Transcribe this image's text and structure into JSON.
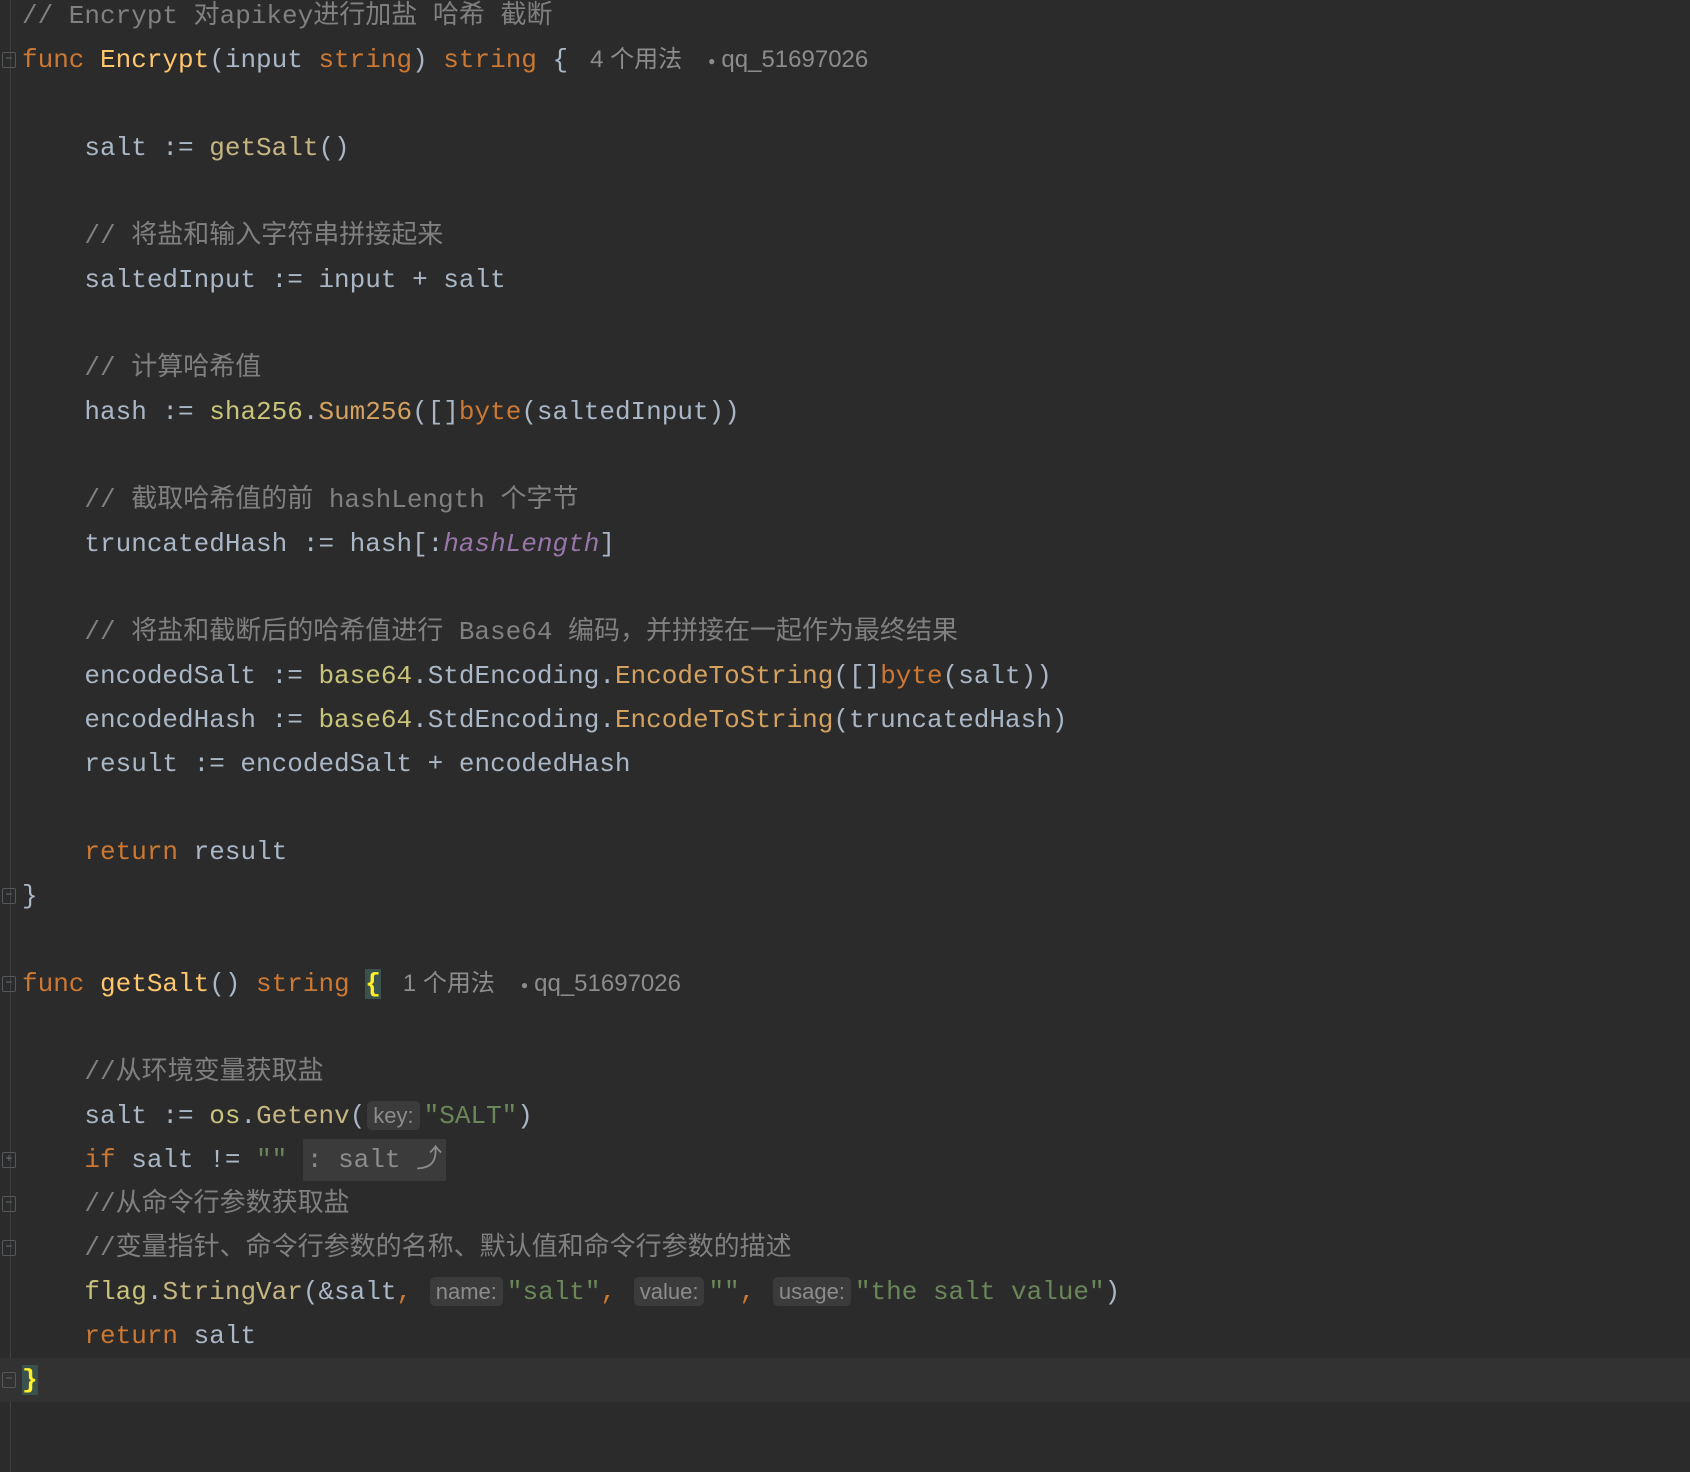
{
  "editor": {
    "language": "Go",
    "current_line": 31,
    "lines": [
      {
        "fold": null,
        "tokens": [
          [
            "cm",
            "// Encrypt 对apikey进行加盐 哈希 截断"
          ]
        ]
      },
      {
        "fold": "open",
        "tokens": [
          [
            "kw",
            "func "
          ],
          [
            "fn",
            "Encrypt"
          ],
          [
            "plain",
            "(input "
          ],
          [
            "kw",
            "string"
          ],
          [
            "plain",
            ") "
          ],
          [
            "kw",
            "string"
          ],
          [
            "plain",
            " {"
          ],
          [
            "usage",
            "4 个用法"
          ],
          [
            "author",
            "qq_51697026"
          ]
        ]
      },
      {
        "fold": null,
        "tokens": []
      },
      {
        "fold": null,
        "tokens": [
          [
            "plain",
            "    salt := "
          ],
          [
            "call",
            "getSalt"
          ],
          [
            "plain",
            "()"
          ]
        ]
      },
      {
        "fold": null,
        "tokens": []
      },
      {
        "fold": null,
        "tokens": [
          [
            "cm",
            "    // 将盐和输入字符串拼接起来"
          ]
        ]
      },
      {
        "fold": null,
        "tokens": [
          [
            "plain",
            "    saltedInput := input + salt"
          ]
        ]
      },
      {
        "fold": null,
        "tokens": []
      },
      {
        "fold": null,
        "tokens": [
          [
            "cm",
            "    // 计算哈希值"
          ]
        ]
      },
      {
        "fold": null,
        "tokens": [
          [
            "plain",
            "    hash := "
          ],
          [
            "pkg",
            "sha256"
          ],
          [
            "plain",
            "."
          ],
          [
            "method",
            "Sum256"
          ],
          [
            "plain",
            "([]"
          ],
          [
            "kw",
            "byte"
          ],
          [
            "plain",
            "(saltedInput))"
          ]
        ]
      },
      {
        "fold": null,
        "tokens": []
      },
      {
        "fold": null,
        "tokens": [
          [
            "cm",
            "    // 截取哈希值的前 hashLength 个字节"
          ]
        ]
      },
      {
        "fold": null,
        "tokens": [
          [
            "plain",
            "    truncatedHash := hash[:"
          ],
          [
            "const",
            "hashLength"
          ],
          [
            "plain",
            "]"
          ]
        ]
      },
      {
        "fold": null,
        "tokens": []
      },
      {
        "fold": null,
        "tokens": [
          [
            "cm",
            "    // 将盐和截断后的哈希值进行 Base64 编码，并拼接在一起作为最终结果"
          ]
        ]
      },
      {
        "fold": null,
        "tokens": [
          [
            "plain",
            "    encodedSalt := "
          ],
          [
            "pkg",
            "base64"
          ],
          [
            "plain",
            "."
          ],
          [
            "plain",
            "StdEncoding"
          ],
          [
            "plain",
            "."
          ],
          [
            "method",
            "EncodeToString"
          ],
          [
            "plain",
            "([]"
          ],
          [
            "kw",
            "byte"
          ],
          [
            "plain",
            "(salt))"
          ]
        ]
      },
      {
        "fold": null,
        "tokens": [
          [
            "plain",
            "    encodedHash := "
          ],
          [
            "pkg",
            "base64"
          ],
          [
            "plain",
            "."
          ],
          [
            "plain",
            "StdEncoding"
          ],
          [
            "plain",
            "."
          ],
          [
            "method",
            "EncodeToString"
          ],
          [
            "plain",
            "(truncatedHash)"
          ]
        ]
      },
      {
        "fold": null,
        "tokens": [
          [
            "plain",
            "    result := encodedSalt + encodedHash"
          ]
        ]
      },
      {
        "fold": null,
        "tokens": []
      },
      {
        "fold": null,
        "tokens": [
          [
            "kw",
            "    return"
          ],
          [
            "plain",
            " result"
          ]
        ]
      },
      {
        "fold": "end",
        "tokens": [
          [
            "plain",
            "}"
          ]
        ]
      },
      {
        "fold": null,
        "tokens": []
      },
      {
        "fold": "open",
        "tokens": [
          [
            "kw",
            "func "
          ],
          [
            "fn",
            "getSalt"
          ],
          [
            "plain",
            "() "
          ],
          [
            "kw",
            "string "
          ],
          [
            "brace",
            "{"
          ],
          [
            "usage",
            "1 个用法"
          ],
          [
            "author",
            "qq_51697026"
          ]
        ]
      },
      {
        "fold": null,
        "tokens": []
      },
      {
        "fold": null,
        "tokens": [
          [
            "cm",
            "    //从环境变量获取盐"
          ]
        ]
      },
      {
        "fold": null,
        "tokens": [
          [
            "plain",
            "    salt := "
          ],
          [
            "pkg",
            "os"
          ],
          [
            "plain",
            "."
          ],
          [
            "call",
            "Getenv"
          ],
          [
            "plain",
            "("
          ],
          [
            "hint",
            "key:"
          ],
          [
            "str",
            "\"SALT\""
          ],
          [
            "plain",
            ")"
          ]
        ]
      },
      {
        "fold": "collapsed",
        "tokens": [
          [
            "kw",
            "    if"
          ],
          [
            "plain",
            " salt != "
          ],
          [
            "str",
            "\"\" "
          ],
          [
            "folded",
            ": salt ⤴"
          ]
        ]
      },
      {
        "fold": "open",
        "tokens": [
          [
            "cm",
            "    //从命令行参数获取盐"
          ]
        ]
      },
      {
        "fold": "end",
        "tokens": [
          [
            "cm",
            "    //变量指针、命令行参数的名称、默认值和命令行参数的描述"
          ]
        ]
      },
      {
        "fold": null,
        "tokens": [
          [
            "pkg",
            "    flag"
          ],
          [
            "plain",
            "."
          ],
          [
            "call",
            "StringVar"
          ],
          [
            "plain",
            "(&salt"
          ],
          [
            "kw",
            ", "
          ],
          [
            "hint",
            "name:"
          ],
          [
            "str",
            "\"salt\""
          ],
          [
            "kw",
            ", "
          ],
          [
            "hint",
            "value:"
          ],
          [
            "str",
            "\"\""
          ],
          [
            "kw",
            ", "
          ],
          [
            "hint",
            "usage:"
          ],
          [
            "str",
            "\"the salt value\""
          ],
          [
            "plain",
            ")"
          ]
        ]
      },
      {
        "fold": null,
        "tokens": [
          [
            "kw",
            "    return"
          ],
          [
            "plain",
            " salt"
          ]
        ]
      },
      {
        "fold": "end",
        "tokens": [
          [
            "caret",
            ""
          ],
          [
            "brace",
            "}"
          ]
        ]
      }
    ]
  }
}
